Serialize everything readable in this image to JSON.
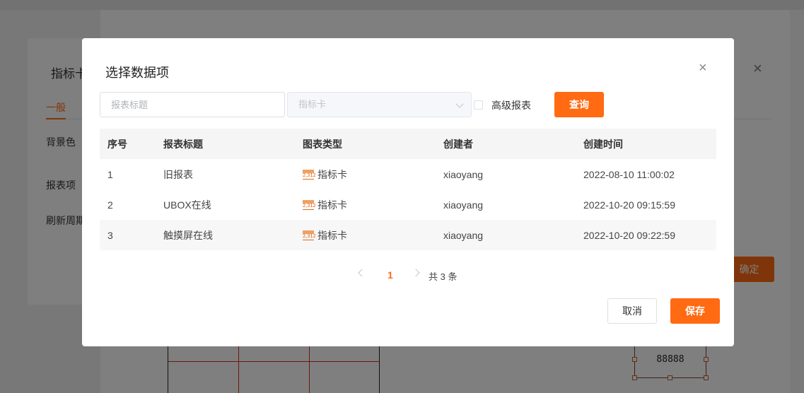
{
  "background": {
    "dialog_title": "指标卡",
    "tab_label": "一般",
    "labels": [
      "背景色",
      "报表项",
      "刷新周期"
    ],
    "confirm_label": "确定",
    "widget_value": "88888"
  },
  "modal": {
    "title": "选择数据项",
    "close_icon": "×",
    "search": {
      "placeholder": "报表标题",
      "value": ""
    },
    "type_select": {
      "placeholder": "指标卡"
    },
    "advanced_label": "高级报表",
    "advanced_checked": false,
    "query_label": "查询",
    "table": {
      "headers": [
        "序号",
        "报表标题",
        "图表类型",
        "创建者",
        "创建时间"
      ],
      "rows": [
        {
          "no": "1",
          "title": "旧报表",
          "type": "指标卡",
          "creator": "xiaoyang",
          "time": "2022-08-10 11:00:02"
        },
        {
          "no": "2",
          "title": "UBOX在线",
          "type": "指标卡",
          "creator": "xiaoyang",
          "time": "2022-10-20 09:15:59"
        },
        {
          "no": "3",
          "title": "触摸屏在线",
          "type": "指标卡",
          "creator": "xiaoyang",
          "time": "2022-10-20 09:22:59"
        }
      ],
      "type_icon_text": "2,312"
    },
    "pagination": {
      "current": "1",
      "total_text": "共 3 条"
    },
    "cancel_label": "取消",
    "save_label": "保存"
  },
  "colors": {
    "accent": "#ff6a13",
    "overlay": "rgba(0,0,0,0.5)"
  }
}
